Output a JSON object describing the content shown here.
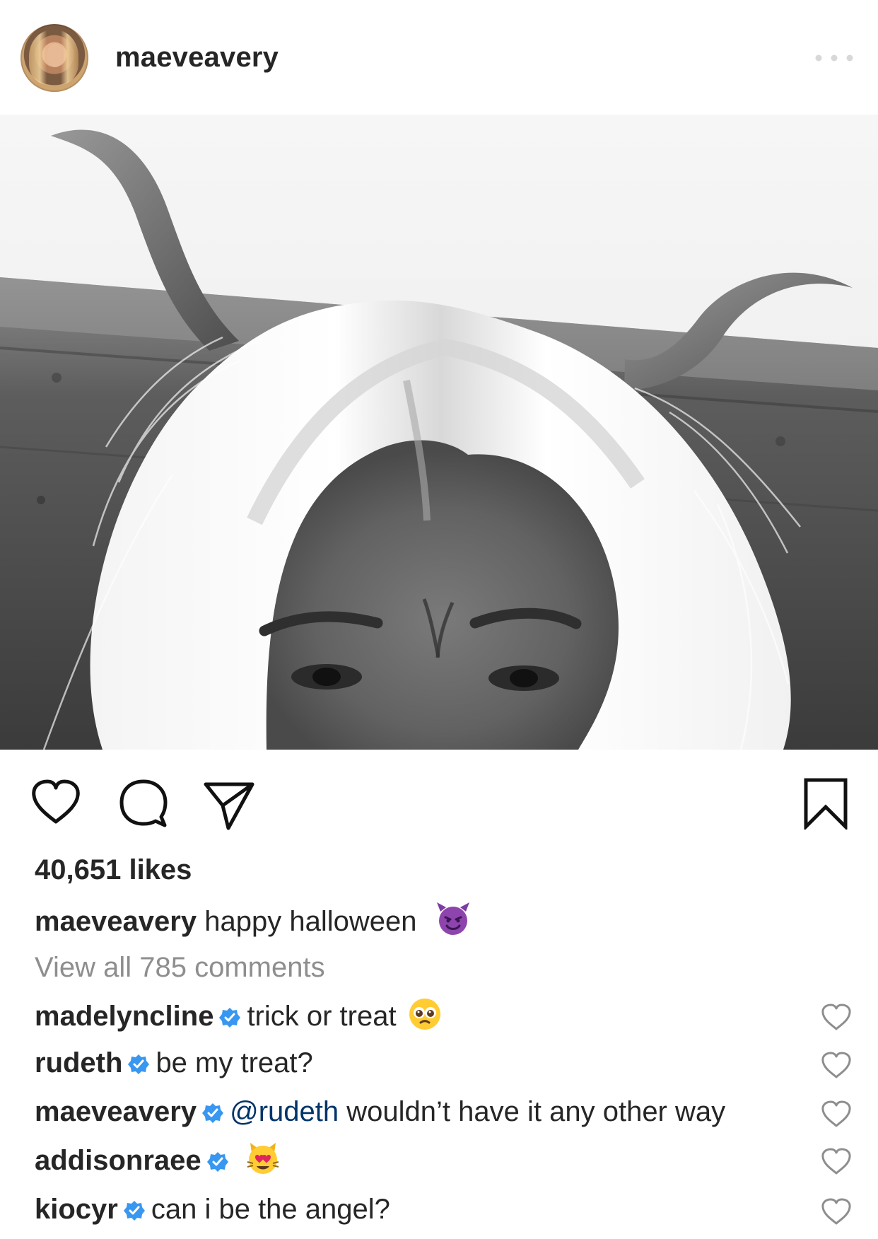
{
  "post": {
    "author": "maeveavery",
    "menu_icon": "more-horizontal-icon",
    "image_icon": "halloween-photo"
  },
  "actions": {
    "like_icon": "heart-icon",
    "comment_icon": "comment-icon",
    "share_icon": "send-icon",
    "save_icon": "bookmark-icon"
  },
  "likes_text": "40,651 likes",
  "caption": {
    "author": "maeveavery",
    "text": "happy halloween",
    "emoji": "smiling-face-with-horns"
  },
  "view_all_comments": "View all 785 comments",
  "comments": [
    {
      "user": "madelyncline",
      "verified": true,
      "mention": "",
      "text": "trick or treat",
      "emoji": "pleading-face",
      "like_icon": "heart-outline-icon"
    },
    {
      "user": "rudeth",
      "verified": true,
      "mention": "",
      "text": "be my treat?",
      "emoji": "",
      "like_icon": "heart-outline-icon"
    },
    {
      "user": "maeveavery",
      "verified": true,
      "mention": "@rudeth",
      "text": "wouldn’t have it any other way",
      "emoji": "",
      "like_icon": "heart-outline-icon"
    },
    {
      "user": "addisonraee",
      "verified": true,
      "mention": "",
      "text": "",
      "emoji": "smiling-cat-with-heart-eyes",
      "like_icon": "heart-outline-icon"
    },
    {
      "user": "kiocyr",
      "verified": true,
      "mention": "",
      "text": "can i be the angel?",
      "emoji": "",
      "like_icon": "heart-outline-icon"
    }
  ],
  "colors": {
    "text": "#262626",
    "secondary_text": "#8e8e8e",
    "verified_blue": "#3897f0",
    "mention": "#003569",
    "purple_emoji": "#8e44ad",
    "yellow_emoji": "#ffcc33"
  }
}
